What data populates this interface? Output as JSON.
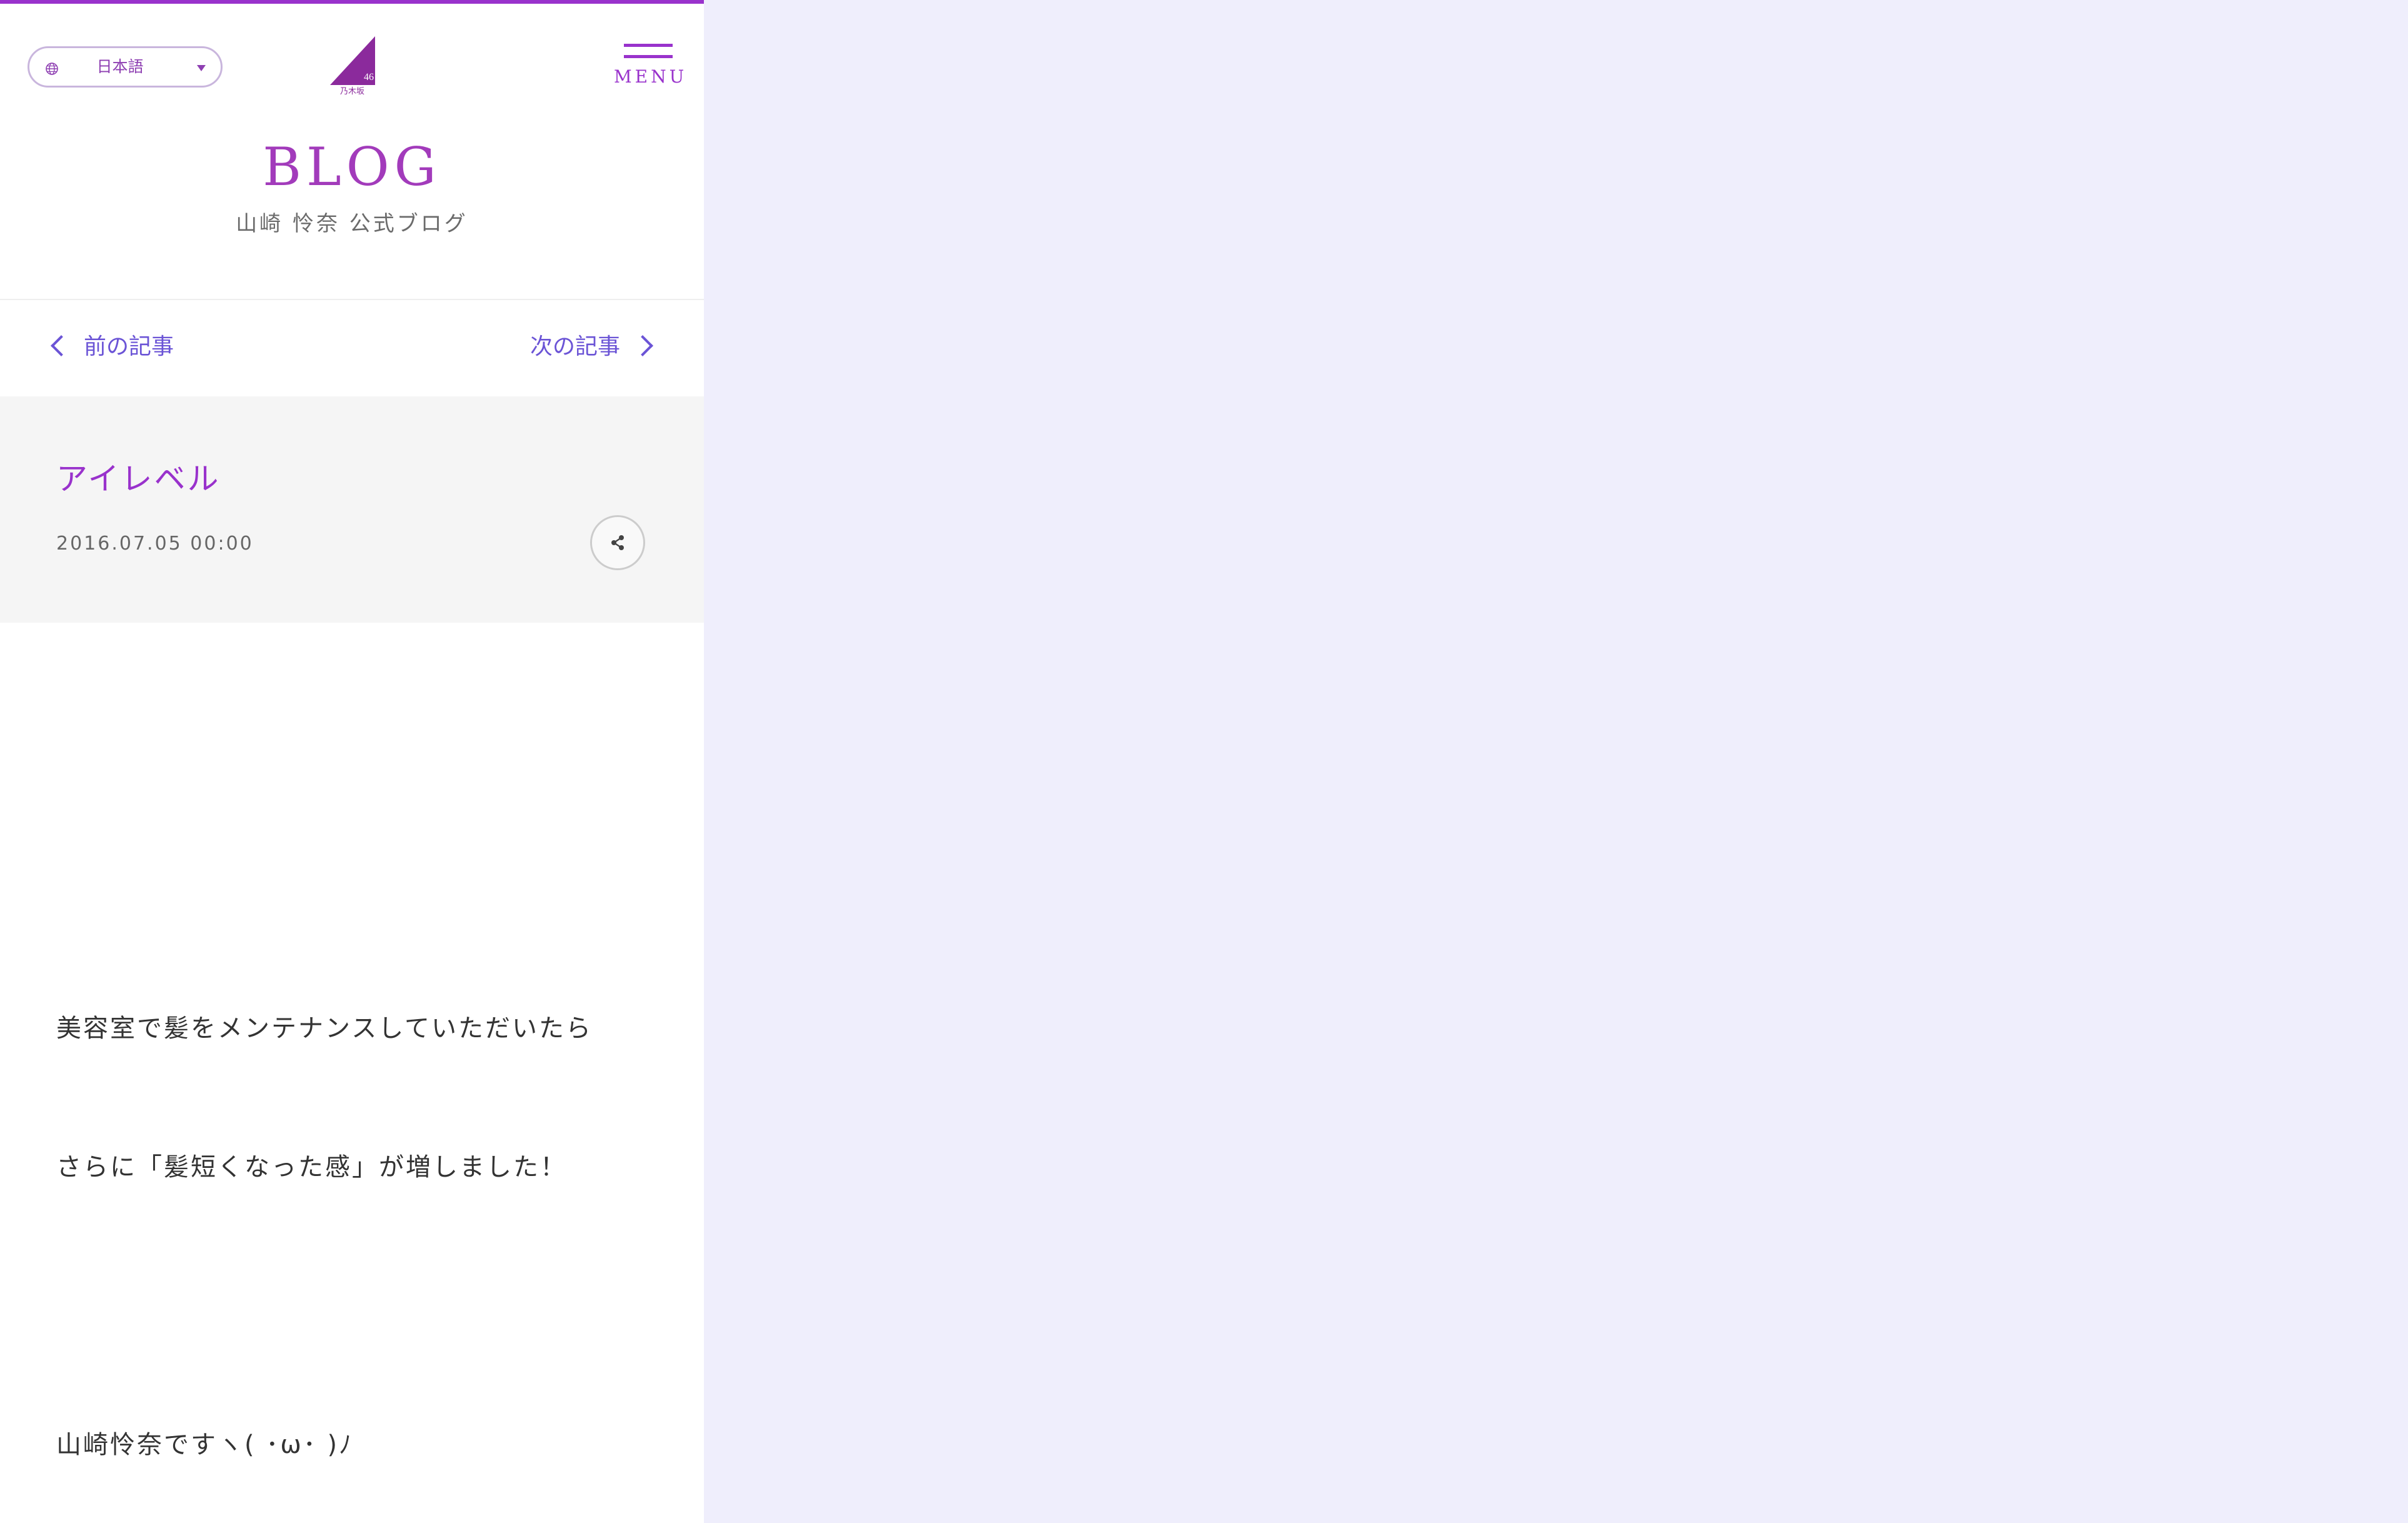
{
  "language": {
    "icon": "globe-icon",
    "selected": "日本語"
  },
  "logo": {
    "icon": "nogizaka46-logo",
    "text": "乃木坂",
    "number": "46"
  },
  "menu": {
    "icon": "hamburger-icon",
    "label": "MENU"
  },
  "page": {
    "title": "BLOG",
    "subtitle": "山崎 怜奈 公式ブログ"
  },
  "nav": {
    "prev_label": "前の記事",
    "next_label": "次の記事"
  },
  "article": {
    "title": "アイレベル",
    "date": "2016.07.05 00:00",
    "share_icon": "share-icon",
    "paragraphs": [
      "美容室で髪をメンテナンスしていただいたら",
      "さらに「髪短くなった感」が増しました！",
      "山崎怜奈ですヽ( ･ω･ )ﾉ"
    ]
  },
  "colors": {
    "accent": "#9932cc",
    "nav_link": "#6b54d6",
    "background": "#efeefc"
  }
}
